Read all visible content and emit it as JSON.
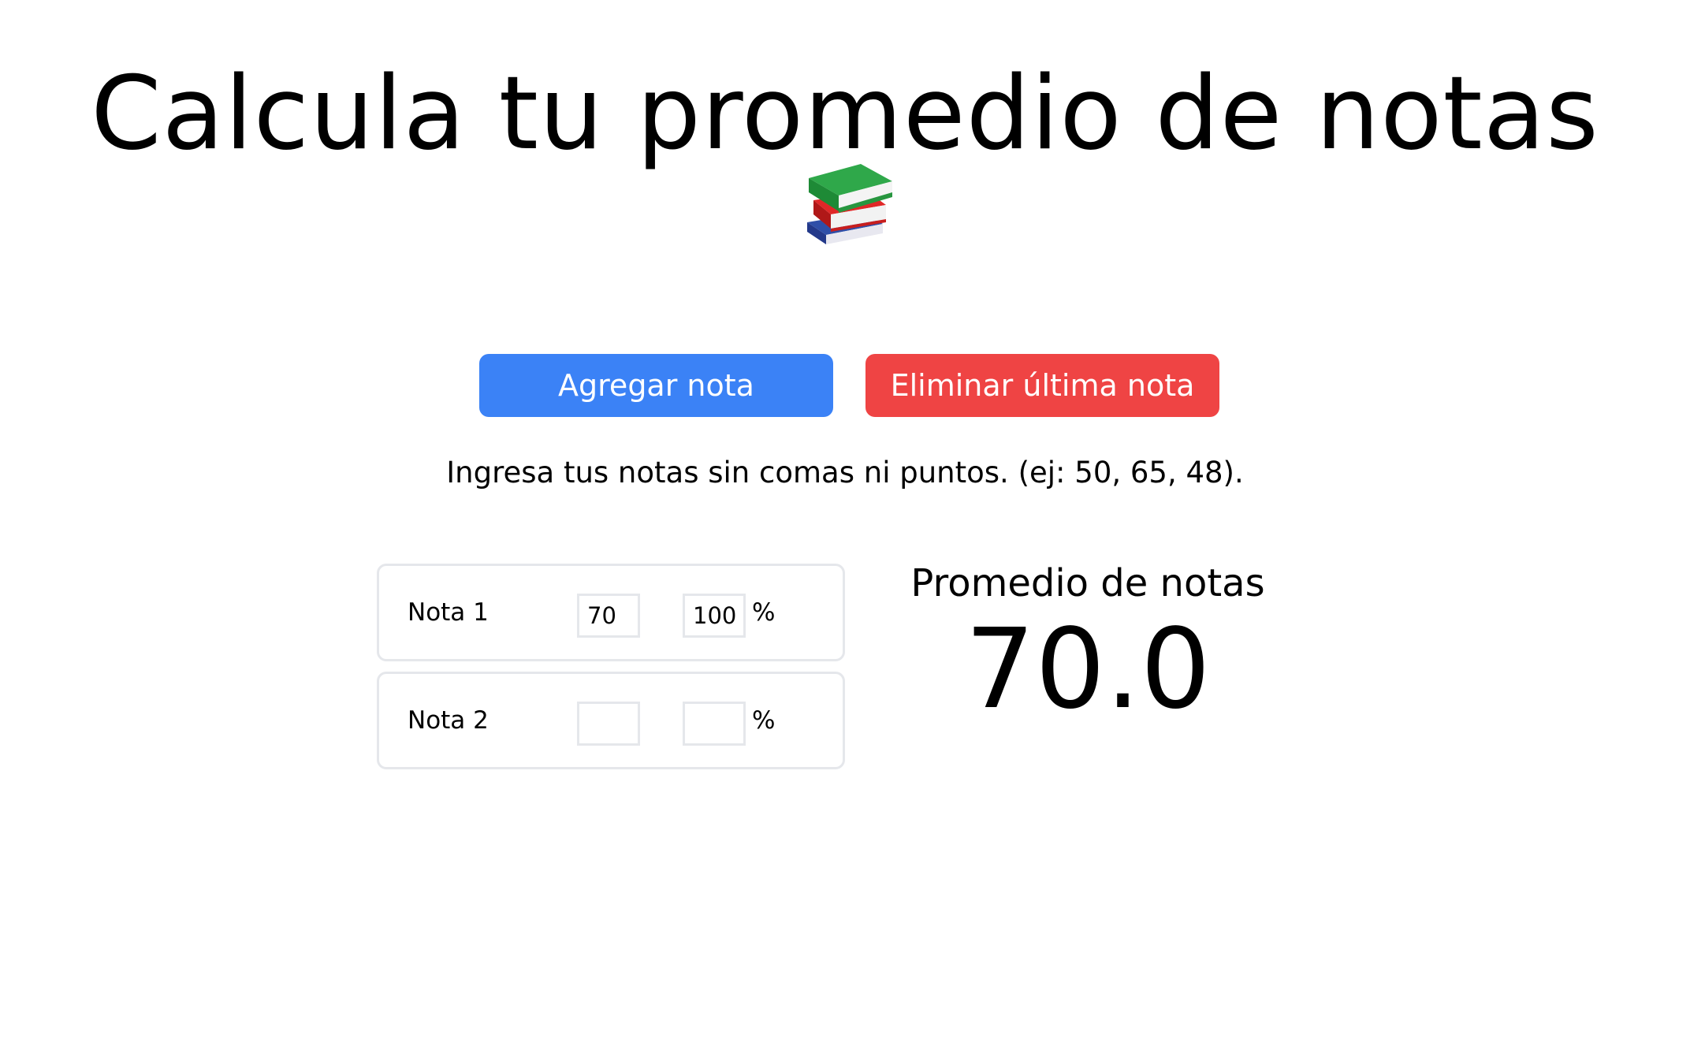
{
  "header": {
    "title": "Calcula tu promedio de notas",
    "emoji_icon": "books-icon"
  },
  "actions": {
    "add_label": "Agregar nota",
    "remove_label": "Eliminar última nota",
    "add_color": "#3b82f6",
    "remove_color": "#ef4444"
  },
  "instructions": "Ingresa tus notas sin comas ni puntos. (ej: 50, 65, 48).",
  "grades": [
    {
      "label": "Nota 1",
      "grade": "70",
      "percent": "100",
      "percent_sign": "%"
    },
    {
      "label": "Nota 2",
      "grade": "",
      "percent": "",
      "percent_sign": "%"
    }
  ],
  "result": {
    "label": "Promedio de notas",
    "value": "70.0"
  }
}
